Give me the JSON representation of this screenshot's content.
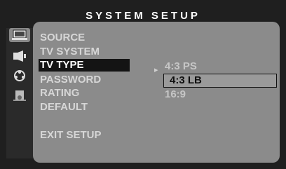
{
  "title": "SYSTEM SETUP",
  "nav_icons": [
    {
      "name": "general-setup-icon",
      "symbol": "💻",
      "active": true
    },
    {
      "name": "audio-setup-icon",
      "symbol": "🔊",
      "active": false
    },
    {
      "name": "video-setup-icon",
      "symbol": "❂",
      "active": false
    },
    {
      "name": "speaker-setup-icon",
      "symbol": "⛁",
      "active": false
    }
  ],
  "menu": {
    "items": [
      "SOURCE",
      "TV SYSTEM",
      "TV TYPE",
      "PASSWORD",
      "RATING",
      "DEFAULT",
      "EXIT SETUP"
    ],
    "selected_index": 2
  },
  "submenu": {
    "arrow": "▸",
    "options": [
      "4:3 PS",
      "4:3 LB",
      "16:9"
    ],
    "active_index": 1
  }
}
